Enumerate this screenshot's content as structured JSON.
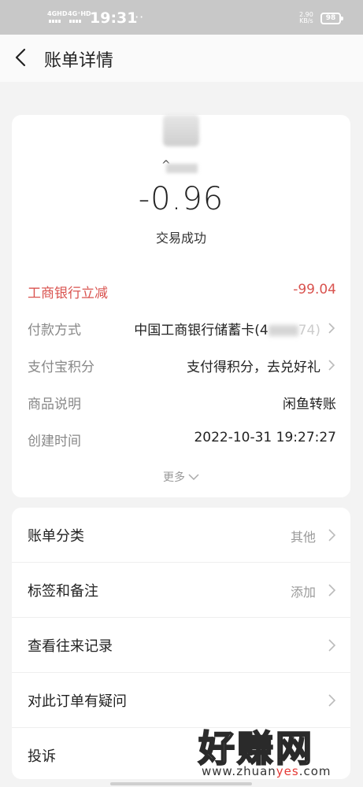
{
  "status_bar": {
    "network1": "4GHD",
    "network2": "4G⁺HD",
    "time": "19:31",
    "more": "···",
    "speed_value": "2.90",
    "speed_unit": "KB/s",
    "battery": "98"
  },
  "nav": {
    "back_icon": "chevron-left-icon",
    "title": "账单详情"
  },
  "summary": {
    "caret": "^",
    "amount": "-0.96",
    "status": "交易成功"
  },
  "details": [
    {
      "label": "工商银行立减",
      "value": "-99.04",
      "highlight": true,
      "arrow": false
    },
    {
      "label": "付款方式",
      "value": "中国工商银行储蓄卡(4",
      "value_masked_suffix": "74)",
      "arrow": true
    },
    {
      "label": "支付宝积分",
      "value": "支付得积分，去兑好礼",
      "arrow": true
    },
    {
      "label": "商品说明",
      "value": "闲鱼转账",
      "arrow": false
    },
    {
      "label": "创建时间",
      "value": "2022-10-31 19:27:27",
      "arrow": false
    }
  ],
  "more_label": "更多",
  "actions": [
    {
      "label": "账单分类",
      "value": "其他"
    },
    {
      "label": "标签和备注",
      "value": "添加"
    },
    {
      "label": "查看往来记录",
      "value": ""
    },
    {
      "label": "对此订单有疑问",
      "value": ""
    },
    {
      "label": "投诉",
      "value": ""
    }
  ],
  "watermark": {
    "text": "好赚网",
    "url_prefix": "www.zhuan",
    "url_highlight": "yes",
    "url_suffix": ".com"
  },
  "colors": {
    "discount_red": "#d9534f",
    "background": "#f3f3f3",
    "status_bar": "#c8c8c8"
  }
}
